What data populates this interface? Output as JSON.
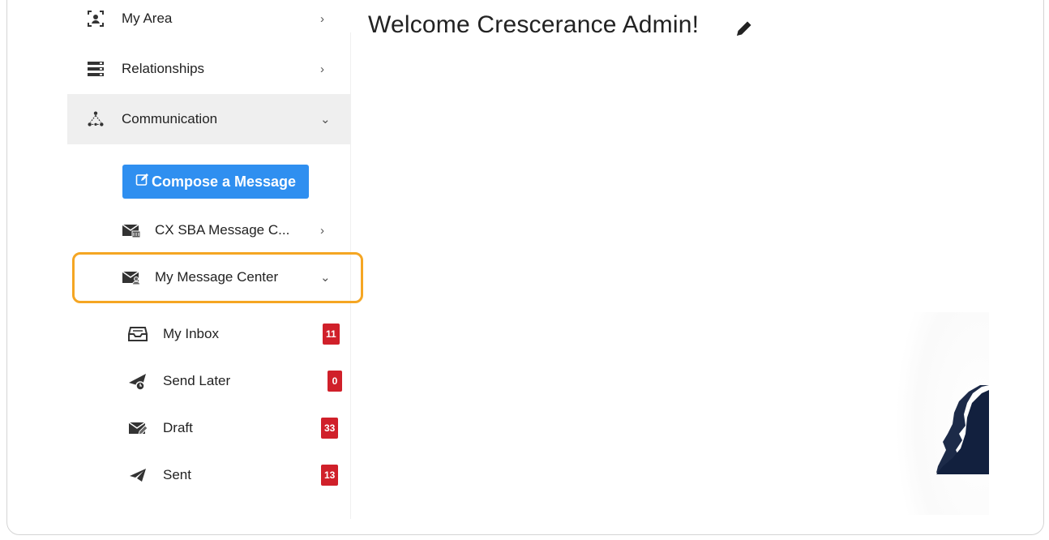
{
  "header": {
    "welcome": "Welcome Crescerance Admin!"
  },
  "sidebar": {
    "my_area": "My Area",
    "relationships": "Relationships",
    "communication": "Communication",
    "compose_button": "Compose a Message",
    "cx_sba": "CX SBA Message C...",
    "my_message_center": "My Message Center",
    "items": [
      {
        "label": "My Inbox",
        "badge": "11"
      },
      {
        "label": "Send Later",
        "badge": "0"
      },
      {
        "label": "Draft",
        "badge": "33"
      },
      {
        "label": "Sent",
        "badge": "13"
      }
    ]
  },
  "colors": {
    "accent": "#2f8ff0",
    "badge": "#d0202a",
    "highlight": "#f5a623"
  }
}
